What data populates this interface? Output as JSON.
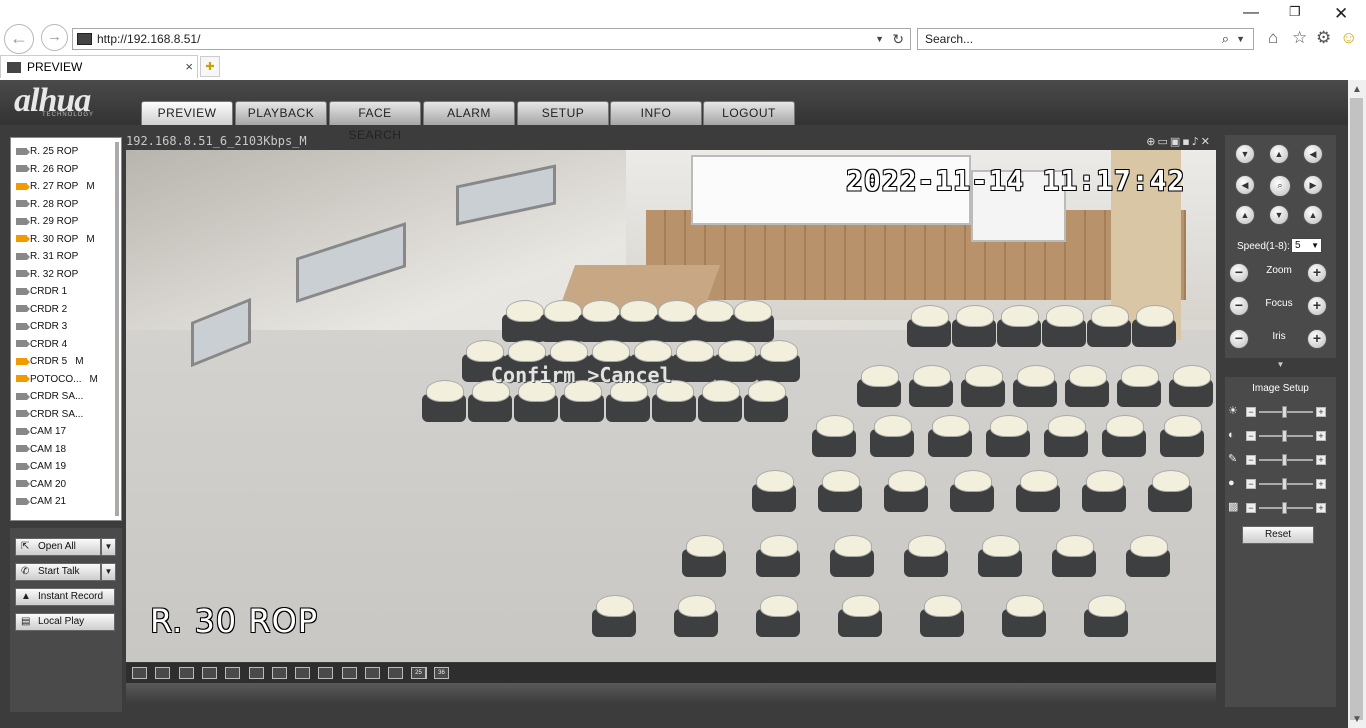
{
  "browser": {
    "url": "http://192.168.8.51/",
    "search_placeholder": "Search...",
    "tab_title": "PREVIEW"
  },
  "app": {
    "logo": "alhua",
    "logo_sub": "TECHNOLOGY",
    "menu": [
      {
        "label": "PREVIEW",
        "active": true
      },
      {
        "label": "PLAYBACK"
      },
      {
        "label": "FACE SEARCH"
      },
      {
        "label": "ALARM"
      },
      {
        "label": "SETUP"
      },
      {
        "label": "INFO"
      },
      {
        "label": "LOGOUT"
      }
    ]
  },
  "channels": [
    {
      "name": "R. 25 ROP"
    },
    {
      "name": "R. 26 ROP"
    },
    {
      "name": "R. 27 ROP",
      "recording": true,
      "mark": "M"
    },
    {
      "name": "R. 28 ROP"
    },
    {
      "name": "R. 29 ROP"
    },
    {
      "name": "R. 30 ROP",
      "recording": true,
      "mark": "M"
    },
    {
      "name": "R. 31 ROP"
    },
    {
      "name": "R. 32 ROP"
    },
    {
      "name": "CRDR 1"
    },
    {
      "name": "CRDR 2"
    },
    {
      "name": "CRDR 3"
    },
    {
      "name": "CRDR 4"
    },
    {
      "name": "CRDR 5",
      "recording": true,
      "mark": "M"
    },
    {
      "name": "POTOCO...",
      "recording": true,
      "mark": "M"
    },
    {
      "name": "CRDR SA..."
    },
    {
      "name": "CRDR SA..."
    },
    {
      "name": "CAM 17"
    },
    {
      "name": "CAM 18"
    },
    {
      "name": "CAM 19"
    },
    {
      "name": "CAM 20"
    },
    {
      "name": "CAM 21"
    }
  ],
  "actions": {
    "open_all": "Open All",
    "start_talk": "Start Talk",
    "instant_record": "Instant Record",
    "local_play": "Local Play"
  },
  "video": {
    "stream_label": "192.168.8.51_6_2103Kbps_M",
    "osd_datetime": "2022-11-14 11:17:42",
    "osd_channel": "R. 30 ROP",
    "osd_menu": "Confirm >Cancel"
  },
  "layout_buttons": [
    "",
    "",
    "",
    "",
    "",
    "",
    "",
    "",
    "",
    "",
    "",
    "",
    "",
    "25",
    "36"
  ],
  "ptz": {
    "speed_label": "Speed(1-8):",
    "speed_value": "5",
    "zoom": "Zoom",
    "focus": "Focus",
    "iris": "Iris"
  },
  "image_setup": {
    "title": "Image Setup",
    "reset": "Reset"
  },
  "colors": {
    "recording": "#f29a00",
    "panel": "#4a4a4a",
    "background": "#3c3c3c"
  }
}
